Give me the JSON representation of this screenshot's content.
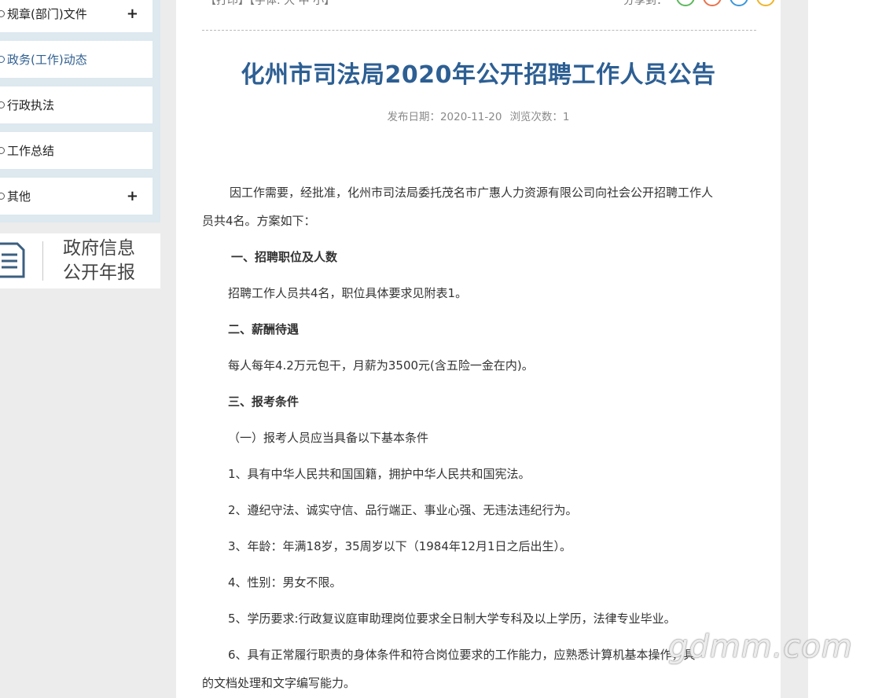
{
  "sidebar": {
    "items": [
      {
        "label": "规章(部门)文件",
        "expandable": true,
        "active": false
      },
      {
        "label": "政务(工作)动态",
        "expandable": false,
        "active": true
      },
      {
        "label": "行政执法",
        "expandable": false,
        "active": false
      },
      {
        "label": "工作总结",
        "expandable": false,
        "active": false
      },
      {
        "label": "其他",
        "expandable": true,
        "active": false
      }
    ],
    "expand_symbol": "+",
    "report_banner": {
      "line1": "政府信息",
      "line2": "公开年报",
      "icon": "document-icon"
    }
  },
  "toolbar": {
    "links": "【打印】【字体: 大 中 小】",
    "share_label": "分享到：",
    "share_icons": [
      "wechat-icon",
      "weibo-icon",
      "qzone-icon",
      "favorite-icon"
    ]
  },
  "article": {
    "title": "化州市司法局2020年公开招聘工作人员公告",
    "publish_date_label": "发布日期：2020-11-20",
    "view_count_label": "浏览次数：1",
    "paragraphs": [
      "因工作需要，经批准，化州市司法局委托茂名市广惠人力资源有限公司向社会公开招聘工作人",
      "员共4名。方案如下：",
      "一、招聘职位及人数",
      "招聘工作人员共4名，职位具体要求见附表1。",
      "二、薪酬待遇",
      "每人每年4.2万元包干，月薪为3500元(含五险一金在内)。",
      "三、报考条件",
      "（一）报考人员应当具备以下基本条件",
      "1、具有中华人民共和国国籍，拥护中华人民共和国宪法。",
      "2、遵纪守法、诚实守信、品行端正、事业心强、无违法违纪行为。",
      "3、年龄：年满18岁，35周岁以下（1984年12月1日之后出生）。",
      "4、性别：男女不限。",
      "5、学历要求:行政复议庭审助理岗位要求全日制大学专科及以上学历，法律专业毕业。",
      "6、具有正常履行职责的身体条件和符合岗位要求的工作能力，应熟悉计算机基本操作，具",
      "的文档处理和文字编写能力。"
    ]
  },
  "watermark": "gdmm.com",
  "colors": {
    "title": "#2d5f93",
    "active_nav": "#2f5f90",
    "sidebar_bg": "#dde8ef"
  }
}
